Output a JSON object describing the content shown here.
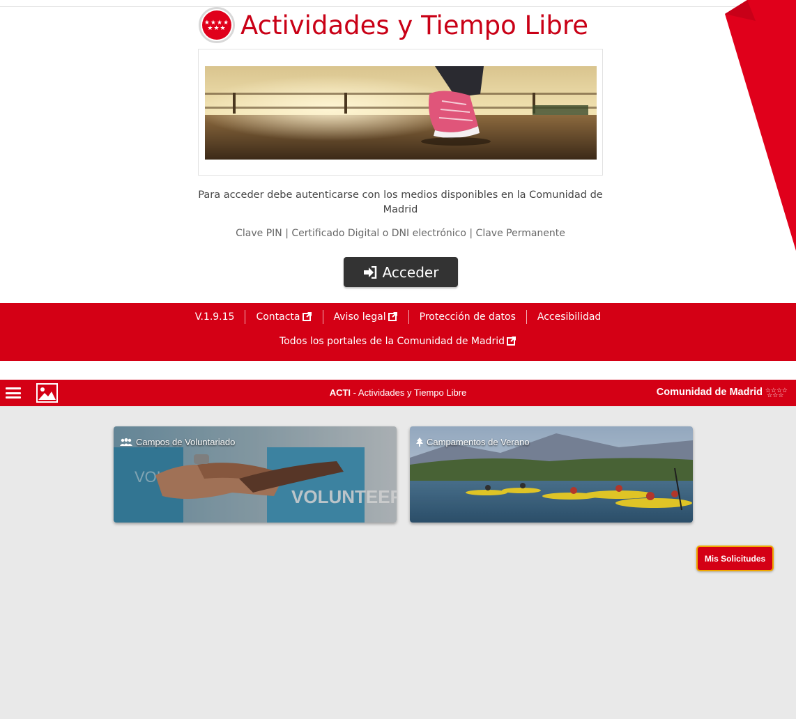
{
  "login": {
    "app_title": "Actividades y Tiempo Libre",
    "auth_message": "Para acceder debe autenticarse con los medios disponibles en la Comunidad de Madrid",
    "auth_methods": "Clave PIN | Certificado Digital o DNI electrónico | Clave Permanente",
    "login_button_label": "Acceder"
  },
  "footer": {
    "version": "V.1.9.15",
    "contact_label": "Contacta",
    "legal_label": "Aviso legal",
    "privacy_label": "Protección de datos",
    "accessibility_label": "Accesibilidad",
    "portals_label": "Todos los portales de la Comunidad de Madrid"
  },
  "app_bar": {
    "acronym": "ACTI",
    "title_rest": " - Actividades y Tiempo Libre",
    "organization": "Comunidad de Madrid"
  },
  "cards": [
    {
      "label": "Campos de Voluntariado",
      "icon": "users-icon"
    },
    {
      "label": "Campamentos de Verano",
      "icon": "tree-icon"
    }
  ],
  "my_requests_button": "Mis Solicitudes",
  "colors": {
    "brand_red": "#d40015",
    "dark_button": "#333333",
    "request_border": "#f0a800",
    "app_background": "#e9e9e9"
  }
}
